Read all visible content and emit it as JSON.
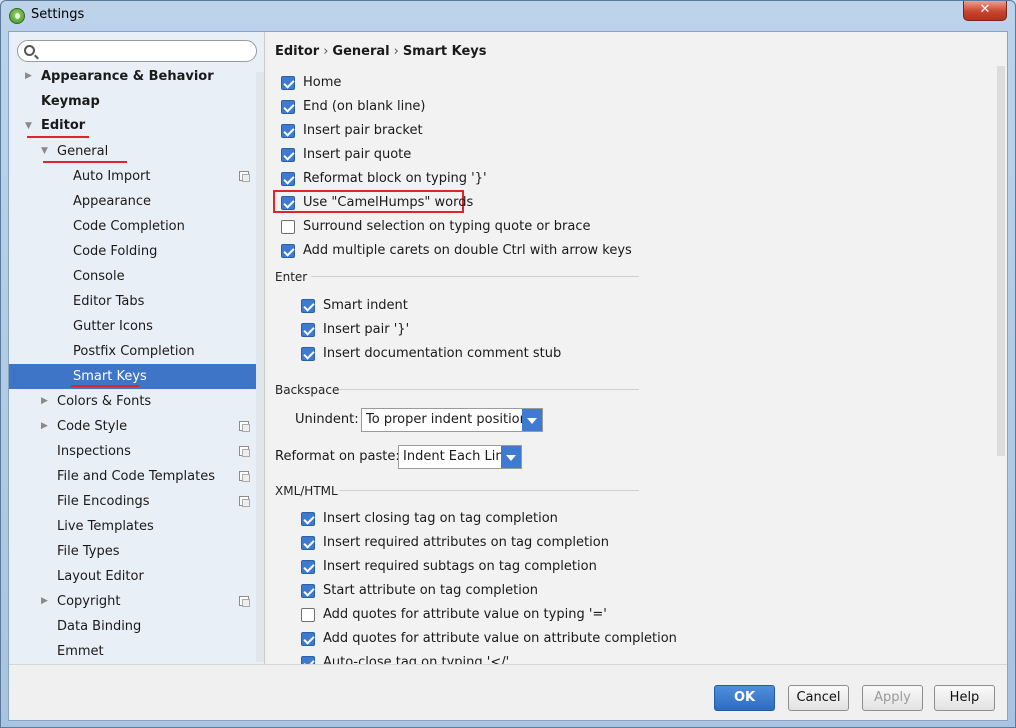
{
  "window": {
    "title": "Settings",
    "close_glyph": "✕"
  },
  "search": {
    "placeholder": "",
    "value": ""
  },
  "sidebar": {
    "items": [
      {
        "label": "Appearance & Behavior",
        "arrow": "▶",
        "bold": true
      },
      {
        "label": "Keymap",
        "arrow": "",
        "bold": true
      },
      {
        "label": "Editor",
        "arrow": "▼",
        "bold": true
      },
      {
        "label": "General",
        "arrow": "▼"
      },
      {
        "label": "Auto Import",
        "proj": true
      },
      {
        "label": "Appearance"
      },
      {
        "label": "Code Completion"
      },
      {
        "label": "Code Folding"
      },
      {
        "label": "Console"
      },
      {
        "label": "Editor Tabs"
      },
      {
        "label": "Gutter Icons"
      },
      {
        "label": "Postfix Completion"
      },
      {
        "label": "Smart Keys",
        "selected": true
      },
      {
        "label": "Colors & Fonts",
        "arrow": "▶"
      },
      {
        "label": "Code Style",
        "arrow": "▶",
        "proj": true
      },
      {
        "label": "Inspections",
        "proj": true
      },
      {
        "label": "File and Code Templates",
        "proj": true
      },
      {
        "label": "File Encodings",
        "proj": true
      },
      {
        "label": "Live Templates"
      },
      {
        "label": "File Types"
      },
      {
        "label": "Layout Editor"
      },
      {
        "label": "Copyright",
        "arrow": "▶",
        "proj": true
      },
      {
        "label": "Data Binding"
      },
      {
        "label": "Emmet"
      }
    ]
  },
  "breadcrumb": {
    "part1": "Editor",
    "part2": "General",
    "part3": "Smart Keys",
    "sep": "›"
  },
  "options": {
    "home": {
      "label": "Home",
      "checked": true
    },
    "end": {
      "label": "End (on blank line)",
      "checked": true
    },
    "pair_bracket": {
      "label": "Insert pair bracket",
      "checked": true
    },
    "pair_quote": {
      "label": "Insert pair quote",
      "checked": true
    },
    "reformat_block": {
      "label": "Reformat block on typing '}'",
      "checked": true
    },
    "camelhumps": {
      "label": "Use \"CamelHumps\" words",
      "checked": true
    },
    "surround": {
      "label": "Surround selection on typing quote or brace",
      "checked": false
    },
    "carets": {
      "label": "Add multiple carets on double Ctrl with arrow keys",
      "checked": true
    }
  },
  "enter": {
    "title": "Enter",
    "smart_indent": {
      "label": "Smart indent",
      "checked": true
    },
    "pair_brace": {
      "label": "Insert pair '}'",
      "checked": true
    },
    "doc_stub": {
      "label": "Insert documentation comment stub",
      "checked": true
    }
  },
  "backspace": {
    "title": "Backspace",
    "unindent_label": "Unindent:",
    "unindent_value": "To proper indent position"
  },
  "reformat": {
    "label": "Reformat on paste:",
    "value": "Indent Each Line"
  },
  "xml": {
    "title": "XML/HTML",
    "closing_tag": {
      "label": "Insert closing tag on tag completion",
      "checked": true
    },
    "req_attrs": {
      "label": "Insert required attributes on tag completion",
      "checked": true
    },
    "req_subtags": {
      "label": "Insert required subtags on tag completion",
      "checked": true
    },
    "start_attr": {
      "label": "Start attribute on tag completion",
      "checked": true
    },
    "quotes_typing": {
      "label": "Add quotes for attribute value on typing '='",
      "checked": false
    },
    "quotes_completion": {
      "label": "Add quotes for attribute value on attribute completion",
      "checked": true
    },
    "auto_close": {
      "label": "Auto-close tag on typing '</'",
      "checked": true
    }
  },
  "buttons": {
    "ok": "OK",
    "cancel": "Cancel",
    "apply": "Apply",
    "help": "Help"
  },
  "colors": {
    "accent": "#3e7bd0",
    "selection": "#3f75c7",
    "annotation": "#e0242b"
  }
}
